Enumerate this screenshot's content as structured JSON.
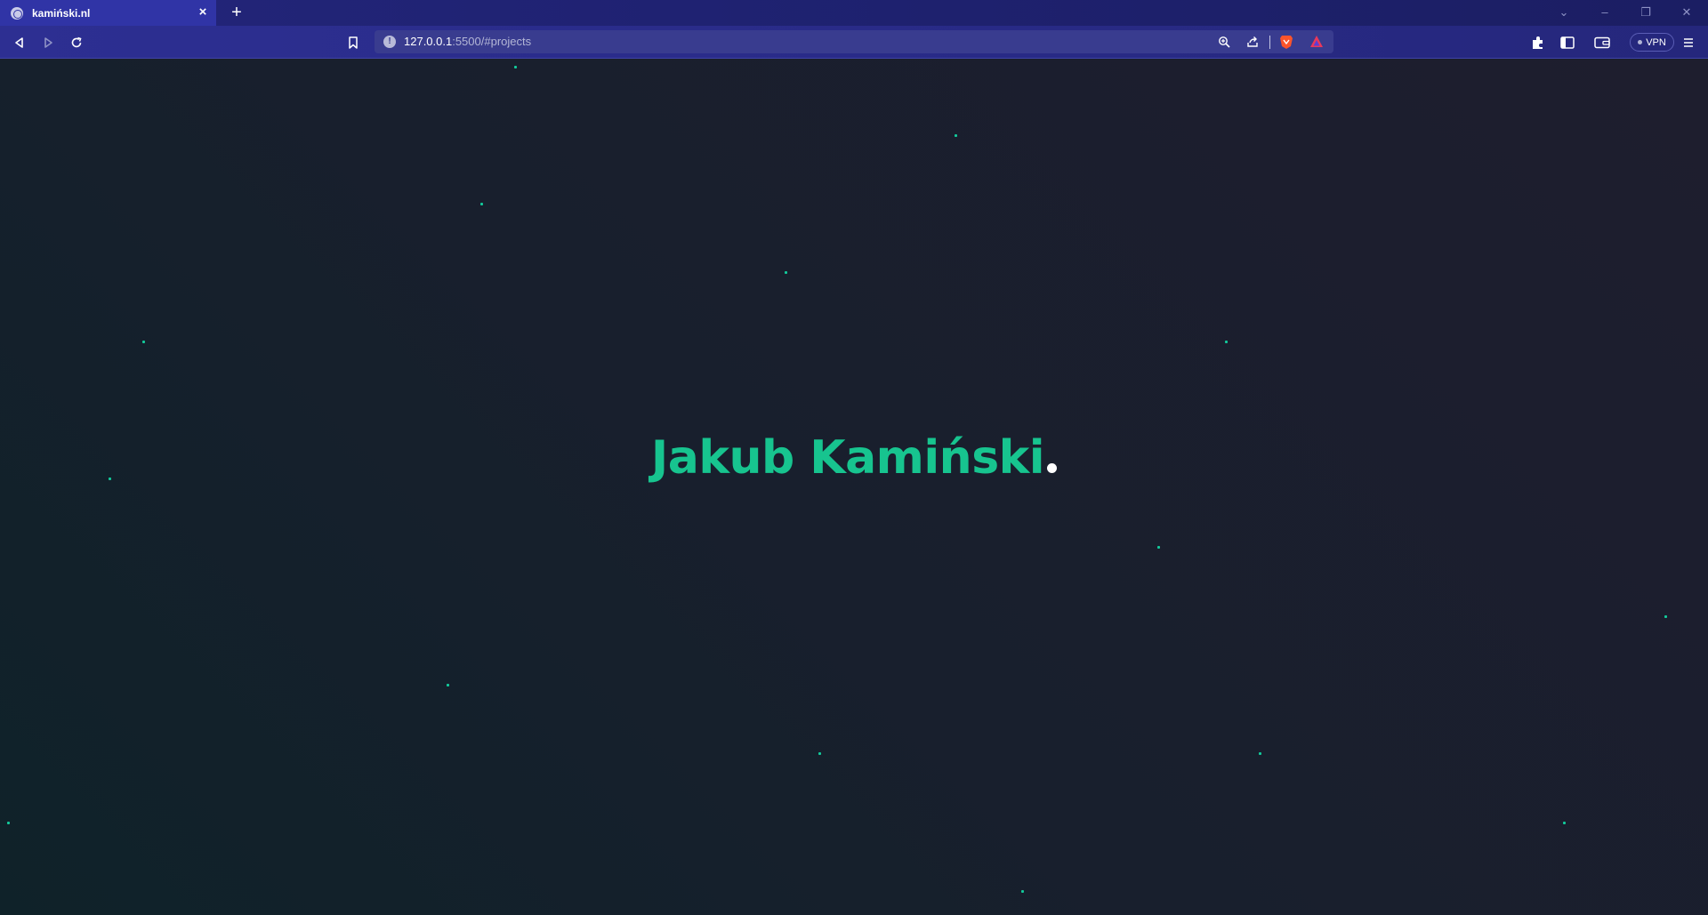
{
  "browser": {
    "tab": {
      "title": "kamiński.nl",
      "close_icon": "×"
    },
    "new_tab_icon": "+",
    "window_controls": {
      "tabs_dropdown": "⌄",
      "minimize": "–",
      "restore": "❐",
      "close": "✕"
    },
    "address": {
      "host": "127.0.0.1",
      "rest": ":5500/#projects"
    },
    "vpn_label": "VPN"
  },
  "hero": {
    "name": "Jakub Kamiński"
  },
  "colors": {
    "accent": "#17c48f",
    "star": "#12c99a",
    "tab_active": "#3034a6",
    "toolbar": "#2d2f92",
    "page_bg": "#1a1f2d"
  }
}
